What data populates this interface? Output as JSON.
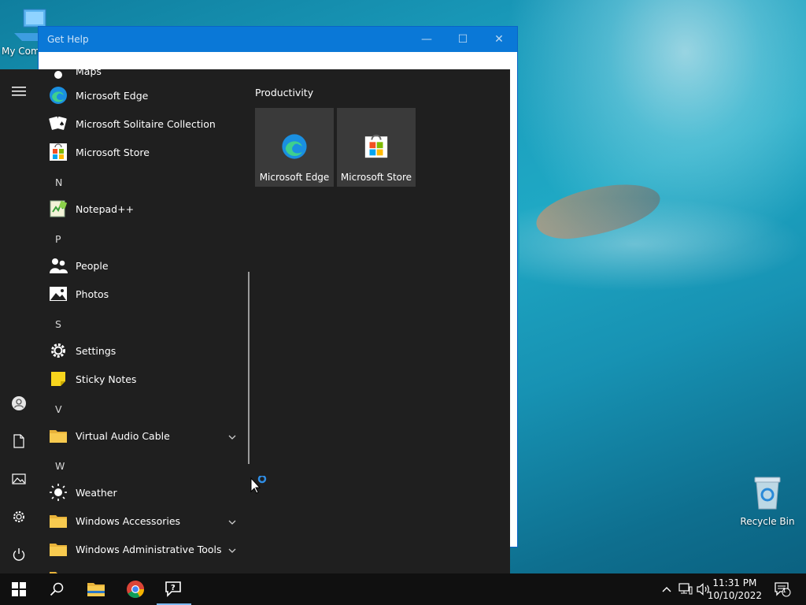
{
  "desktop": {
    "my_computer_label": "My Com",
    "recycle_bin_label": "Recycle Bin"
  },
  "get_help": {
    "title": "Get Help",
    "minimize": "—",
    "maximize": "☐",
    "close": "✕"
  },
  "start_menu": {
    "partial_top": "Maps",
    "items": [
      {
        "type": "app",
        "label": "Microsoft Edge",
        "icon": "edge-icon"
      },
      {
        "type": "app",
        "label": "Microsoft Solitaire Collection",
        "icon": "solitaire-icon"
      },
      {
        "type": "app",
        "label": "Microsoft Store",
        "icon": "store-icon"
      },
      {
        "type": "letter",
        "label": "N"
      },
      {
        "type": "app",
        "label": "Notepad++",
        "icon": "notepadpp-icon"
      },
      {
        "type": "letter",
        "label": "P"
      },
      {
        "type": "app",
        "label": "People",
        "icon": "people-icon"
      },
      {
        "type": "app",
        "label": "Photos",
        "icon": "photos-icon"
      },
      {
        "type": "letter",
        "label": "S"
      },
      {
        "type": "app",
        "label": "Settings",
        "icon": "gear-icon"
      },
      {
        "type": "app",
        "label": "Sticky Notes",
        "icon": "sticky-notes-icon"
      },
      {
        "type": "letter",
        "label": "V"
      },
      {
        "type": "folder",
        "label": "Virtual Audio Cable",
        "icon": "folder-icon"
      },
      {
        "type": "letter",
        "label": "W"
      },
      {
        "type": "app",
        "label": "Weather",
        "icon": "weather-icon"
      },
      {
        "type": "folder",
        "label": "Windows Accessories",
        "icon": "folder-icon"
      },
      {
        "type": "folder",
        "label": "Windows Administrative Tools",
        "icon": "folder-icon"
      }
    ],
    "tiles_group": "Productivity",
    "tiles": [
      {
        "label": "Microsoft Edge",
        "icon": "edge-icon"
      },
      {
        "label": "Microsoft Store",
        "icon": "store-icon"
      }
    ]
  },
  "taskbar": {
    "time": "11:31 PM",
    "date": "10/10/2022",
    "notification_count": "1",
    "pinned": [
      "start-icon",
      "search-icon",
      "file-explorer-icon",
      "chrome-icon",
      "get-help-icon"
    ]
  },
  "colors": {
    "accent": "#0a78d7",
    "start_bg": "#1f1f1f",
    "taskbar_bg": "#101010",
    "tile_bg": "#3a3a3a"
  }
}
